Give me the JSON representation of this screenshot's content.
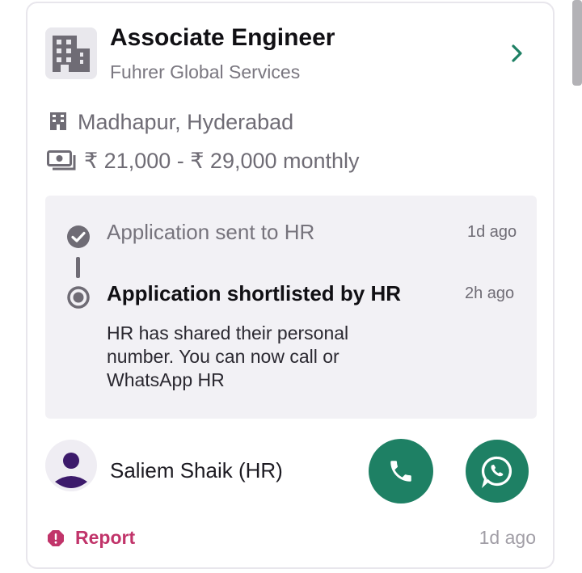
{
  "job": {
    "title": "Associate Engineer",
    "company": "Fuhrer Global Services",
    "location": "Madhapur, Hyderabad",
    "salary": "₹ 21,000 - ₹ 29,000 monthly"
  },
  "timeline": {
    "steps": [
      {
        "label": "Application sent to HR",
        "time": "1d ago",
        "status": "done"
      },
      {
        "label": "Application shortlisted by HR",
        "time": "2h ago",
        "status": "current"
      }
    ],
    "description": "HR has shared their personal number. You can now call or WhatsApp HR"
  },
  "contact": {
    "name": "Saliem Shaik (HR)",
    "call_icon": "phone-icon",
    "whatsapp_icon": "whatsapp-icon"
  },
  "footer": {
    "report_label": "Report",
    "posted_time": "1d ago"
  },
  "colors": {
    "brand_green": "#1e8064",
    "report_red": "#c1346a",
    "timeline_bg": "#f2f1f5",
    "chevron": "#1e8064"
  }
}
